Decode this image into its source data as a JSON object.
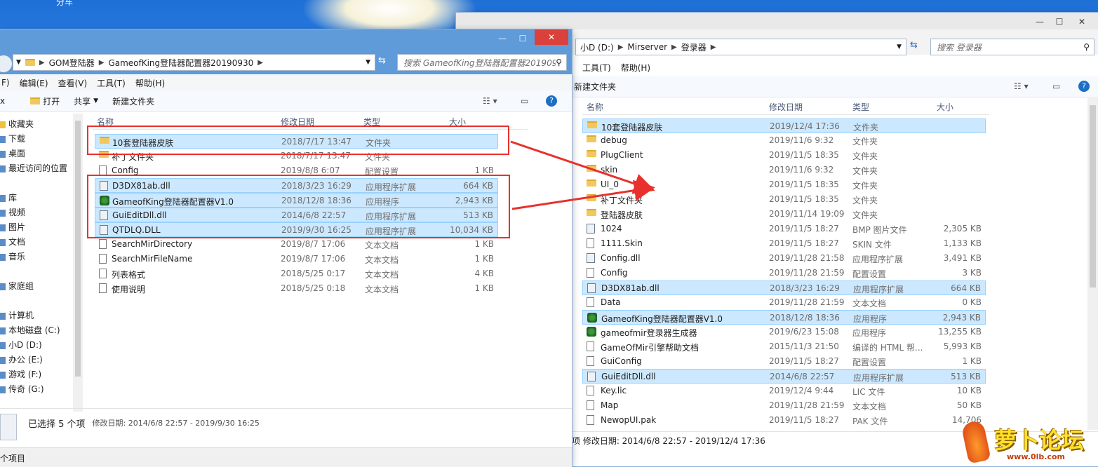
{
  "desktop": {
    "top_left_text": "分车"
  },
  "left_window": {
    "address": [
      "GOM登陆器",
      "GameofKing登陆器配置器20190930"
    ],
    "search_placeholder": "搜索 GameofKing登陆器配置器201909...",
    "menu": [
      "F)",
      "编辑(E)",
      "查看(V)",
      "工具(T)",
      "帮助(H)"
    ],
    "toolbar": {
      "open": "打开",
      "share": "共享",
      "new_folder": "新建文件夹"
    },
    "columns": {
      "name": "名称",
      "date": "修改日期",
      "type": "类型",
      "size": "大小"
    },
    "nav": [
      {
        "label": "收藏夹",
        "icon": "star-icon"
      },
      {
        "label": "下载",
        "icon": "download-icon"
      },
      {
        "label": "桌面",
        "icon": "desktop-icon"
      },
      {
        "label": "最近访问的位置",
        "icon": "recent-icon"
      },
      {
        "label": "库",
        "icon": "library-icon"
      },
      {
        "label": "视频",
        "icon": "video-icon"
      },
      {
        "label": "图片",
        "icon": "picture-icon"
      },
      {
        "label": "文档",
        "icon": "document-icon"
      },
      {
        "label": "音乐",
        "icon": "music-icon"
      },
      {
        "label": "家庭组",
        "icon": "homegroup-icon"
      },
      {
        "label": "计算机",
        "icon": "computer-icon"
      },
      {
        "label": "本地磁盘 (C:)",
        "icon": "drive-icon"
      },
      {
        "label": "小D (D:)",
        "icon": "drive-icon"
      },
      {
        "label": "办公 (E:)",
        "icon": "drive-icon"
      },
      {
        "label": "游戏 (F:)",
        "icon": "drive-icon"
      },
      {
        "label": "传奇 (G:)",
        "icon": "drive-icon"
      }
    ],
    "files": [
      {
        "name": "10套登陆器皮肤",
        "date": "2018/7/17 13:47",
        "type": "文件夹",
        "size": "",
        "icon": "folder",
        "selected": true
      },
      {
        "name": "补丁文件夹",
        "date": "2018/7/17 13:47",
        "type": "文件夹",
        "size": "",
        "icon": "folder",
        "selected": false
      },
      {
        "name": "Config",
        "date": "2019/8/8 6:07",
        "type": "配置设置",
        "size": "1 KB",
        "icon": "file",
        "selected": false
      },
      {
        "name": "D3DX81ab.dll",
        "date": "2018/3/23 16:29",
        "type": "应用程序扩展",
        "size": "664 KB",
        "icon": "dll",
        "selected": true
      },
      {
        "name": "GameofKing登陆器配置器V1.0",
        "date": "2018/12/8 18:36",
        "type": "应用程序",
        "size": "2,943 KB",
        "icon": "exe",
        "selected": true
      },
      {
        "name": "GuiEditDll.dll",
        "date": "2014/6/8 22:57",
        "type": "应用程序扩展",
        "size": "513 KB",
        "icon": "dll",
        "selected": true
      },
      {
        "name": "QTDLQ.DLL",
        "date": "2019/9/30 16:25",
        "type": "应用程序扩展",
        "size": "10,034 KB",
        "icon": "dll",
        "selected": true
      },
      {
        "name": "SearchMirDirectory",
        "date": "2019/8/7 17:06",
        "type": "文本文档",
        "size": "1 KB",
        "icon": "file",
        "selected": false
      },
      {
        "name": "SearchMirFileName",
        "date": "2019/8/7 17:06",
        "type": "文本文档",
        "size": "1 KB",
        "icon": "file",
        "selected": false
      },
      {
        "name": "列表格式",
        "date": "2018/5/25 0:17",
        "type": "文本文档",
        "size": "4 KB",
        "icon": "file",
        "selected": false
      },
      {
        "name": "使用说明",
        "date": "2018/5/25 0:18",
        "type": "文本文档",
        "size": "1 KB",
        "icon": "file",
        "selected": false
      }
    ],
    "status": {
      "selected": "已选择 5 个项",
      "dates": "修改日期: 2014/6/8 22:57 - 2019/9/30 16:25",
      "bottom": "个项目"
    }
  },
  "right_window": {
    "address": [
      "小D (D:)",
      "Mirserver",
      "登录器"
    ],
    "search_placeholder": "搜索 登录器",
    "menu": [
      "工具(T)",
      "帮助(H)"
    ],
    "toolbar": {
      "new_folder": "新建文件夹"
    },
    "columns": {
      "name": "名称",
      "date": "修改日期",
      "type": "类型",
      "size": "大小"
    },
    "files": [
      {
        "name": "10套登陆器皮肤",
        "date": "2019/12/4 17:36",
        "type": "文件夹",
        "size": "",
        "icon": "folder",
        "hl": true
      },
      {
        "name": "debug",
        "date": "2019/11/6 9:32",
        "type": "文件夹",
        "size": "",
        "icon": "folder",
        "hl": false
      },
      {
        "name": "PlugClient",
        "date": "2019/11/5 18:35",
        "type": "文件夹",
        "size": "",
        "icon": "folder",
        "hl": false
      },
      {
        "name": "skin",
        "date": "2019/11/6 9:32",
        "type": "文件夹",
        "size": "",
        "icon": "folder",
        "hl": false
      },
      {
        "name": "UI_0",
        "date": "2019/11/5 18:35",
        "type": "文件夹",
        "size": "",
        "icon": "folder",
        "hl": false
      },
      {
        "name": "补丁文件夹",
        "date": "2019/11/5 18:35",
        "type": "文件夹",
        "size": "",
        "icon": "folder",
        "hl": false
      },
      {
        "name": "登陆器皮肤",
        "date": "2019/11/14 19:09",
        "type": "文件夹",
        "size": "",
        "icon": "folder",
        "hl": false
      },
      {
        "name": "1024",
        "date": "2019/11/5 18:27",
        "type": "BMP 图片文件",
        "size": "2,305 KB",
        "icon": "dll",
        "hl": false
      },
      {
        "name": "1111.Skin",
        "date": "2019/11/5 18:27",
        "type": "SKIN 文件",
        "size": "1,133 KB",
        "icon": "file",
        "hl": false
      },
      {
        "name": "Config.dll",
        "date": "2019/11/28 21:58",
        "type": "应用程序扩展",
        "size": "3,491 KB",
        "icon": "dll",
        "hl": false
      },
      {
        "name": "Config",
        "date": "2019/11/28 21:59",
        "type": "配置设置",
        "size": "3 KB",
        "icon": "file",
        "hl": false
      },
      {
        "name": "D3DX81ab.dll",
        "date": "2018/3/23 16:29",
        "type": "应用程序扩展",
        "size": "664 KB",
        "icon": "dll",
        "hl": true
      },
      {
        "name": "Data",
        "date": "2019/11/28 21:59",
        "type": "文本文档",
        "size": "0 KB",
        "icon": "file",
        "hl": false
      },
      {
        "name": "GameofKing登陆器配置器V1.0",
        "date": "2018/12/8 18:36",
        "type": "应用程序",
        "size": "2,943 KB",
        "icon": "exe",
        "hl": true
      },
      {
        "name": "gameofmir登录器生成器",
        "date": "2019/6/23 15:08",
        "type": "应用程序",
        "size": "13,255 KB",
        "icon": "exe",
        "hl": false
      },
      {
        "name": "GameOfMir引擎帮助文档",
        "date": "2015/11/3 21:50",
        "type": "编译的 HTML 帮...",
        "size": "5,993 KB",
        "icon": "file",
        "hl": false
      },
      {
        "name": "GuiConfig",
        "date": "2019/11/5 18:27",
        "type": "配置设置",
        "size": "1 KB",
        "icon": "file",
        "hl": false
      },
      {
        "name": "GuiEditDll.dll",
        "date": "2014/6/8 22:57",
        "type": "应用程序扩展",
        "size": "513 KB",
        "icon": "dll",
        "hl": true
      },
      {
        "name": "Key.lic",
        "date": "2019/12/4 9:44",
        "type": "LIC 文件",
        "size": "10 KB",
        "icon": "file",
        "hl": false
      },
      {
        "name": "Map",
        "date": "2019/11/28 21:59",
        "type": "文本文档",
        "size": "50 KB",
        "icon": "file",
        "hl": false
      },
      {
        "name": "NewopUI.pak",
        "date": "2019/11/5 18:27",
        "type": "PAK 文件",
        "size": "14,706",
        "icon": "file",
        "hl": false
      }
    ],
    "status": {
      "dates": "项  修改日期: 2014/6/8 22:57 - 2019/12/4 17:36"
    }
  },
  "watermark": {
    "text": "萝卜论坛",
    "url": "www.0lb.com"
  },
  "colors": {
    "accent": "#5f9ad9",
    "red_annotation": "#e8312c",
    "selection": "#cce8ff"
  }
}
